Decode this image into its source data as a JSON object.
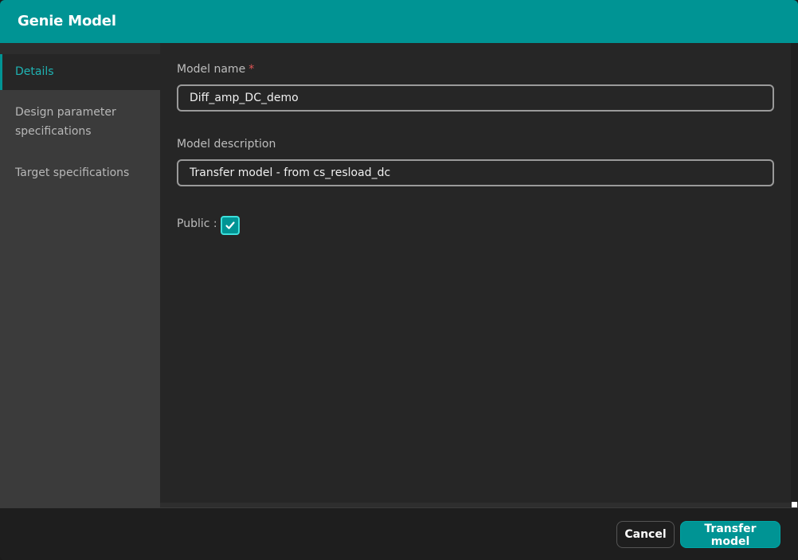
{
  "dialog": {
    "title": "Genie Model"
  },
  "sidebar": {
    "items": [
      {
        "label": "Details",
        "active": true
      },
      {
        "label": "Design parameter specifications",
        "active": false
      },
      {
        "label": "Target specifications",
        "active": false
      }
    ]
  },
  "form": {
    "model_name_label": "Model name",
    "required_mark": "*",
    "model_name_value": "Diff_amp_DC_demo",
    "model_description_label": "Model description",
    "model_description_value": "Transfer model - from cs_resload_dc",
    "public_label": "Public :",
    "public_checked": true
  },
  "footer": {
    "cancel_label": "Cancel",
    "submit_label": "Transfer model"
  },
  "colors": {
    "accent": "#009494",
    "accent_light": "#3de0dc",
    "required": "#e05555",
    "background": "#262626",
    "sidebar": "#3b3b3b"
  },
  "icons": {
    "checkbox": "checkmark-icon"
  }
}
